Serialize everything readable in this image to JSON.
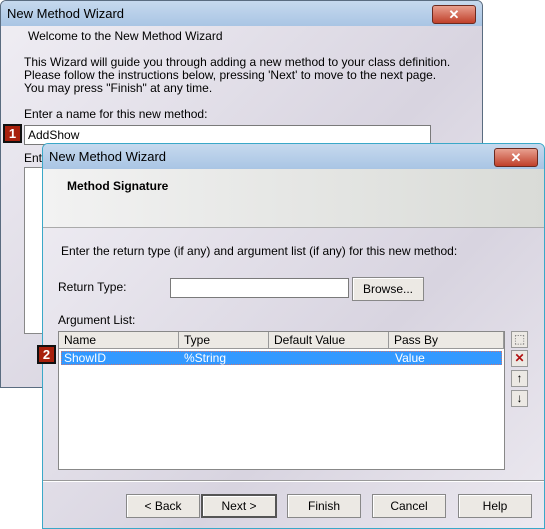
{
  "back_window": {
    "title": "New Method Wizard",
    "heading": "Welcome to the New Method Wizard",
    "intro": [
      "This Wizard will guide you through adding a new method to your class definition.",
      "Please follow the instructions below, pressing 'Next' to move to the next page.",
      "You may press \"Finish\" at any time."
    ],
    "name_label": "Enter a name for this new method:",
    "name_value": "AddShow",
    "second_label": "Ente",
    "badge": "1"
  },
  "front_window": {
    "title": "New Method Wizard",
    "heading": "Method Signature",
    "instruction": "Enter the return type (if any) and argument list (if any) for this new method:",
    "return_type_label": "Return Type:",
    "return_type_value": "",
    "browse": "Browse...",
    "argument_list_label": "Argument List:",
    "columns": [
      "Name",
      "Type",
      "Default Value",
      "Pass By"
    ],
    "rows": [
      {
        "name": "ShowID",
        "type": "%String",
        "default": "",
        "pass_by": "Value"
      }
    ],
    "badge": "2",
    "side_buttons": [
      "new-icon",
      "delete-icon",
      "arrow-up-icon",
      "arrow-down-icon"
    ],
    "buttons": {
      "back": "< Back",
      "next": "Next >",
      "finish": "Finish",
      "cancel": "Cancel",
      "help": "Help"
    }
  },
  "colors": {
    "selection": "#3399ff",
    "badge": "#a8200c"
  }
}
